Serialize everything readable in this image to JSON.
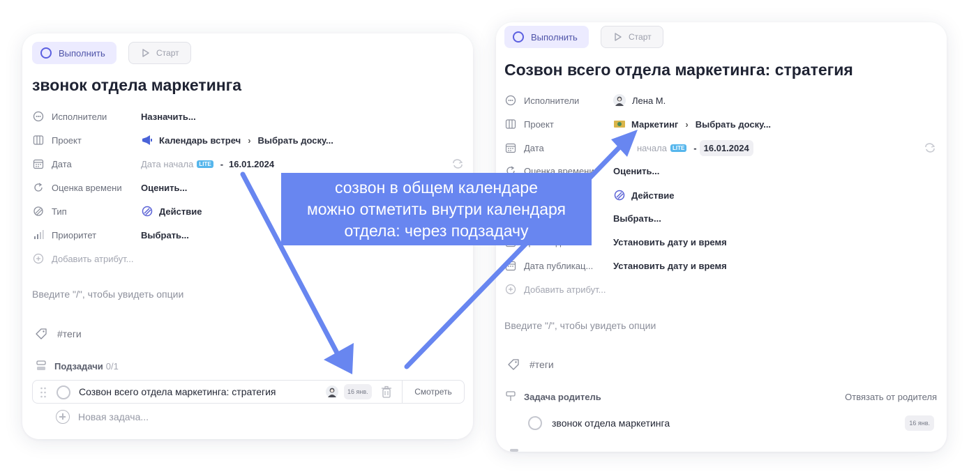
{
  "left_card": {
    "complete_button": "Выполнить",
    "start_button": "Старт",
    "title": "звонок отдела маркетинга",
    "attributes": [
      {
        "label": "Исполнители",
        "value": "Назначить..."
      },
      {
        "label": "Проект",
        "project": "Календарь встреч",
        "board": "Выбрать доску..."
      },
      {
        "label": "Дата",
        "start_placeholder": "Дата начала",
        "badge": "LITE",
        "separator": "-",
        "end_date": "16.01.2024"
      },
      {
        "label": "Оценка времени",
        "value": "Оценить..."
      },
      {
        "label": "Тип",
        "value": "Действие"
      },
      {
        "label": "Приоритет",
        "value": "Выбрать..."
      },
      {
        "label": "Добавить атрибут..."
      }
    ],
    "editor_placeholder": "Введите \"/\", чтобы увидеть опции",
    "tags": "#теги",
    "subtasks": {
      "heading": "Подзадачи",
      "count": "0/1",
      "items": [
        {
          "title": "Созвон всего отдела маркетинга: стратегия",
          "date": "16 янв.",
          "view_button": "Смотреть"
        }
      ],
      "new_task": "Новая задача..."
    }
  },
  "right_card": {
    "complete_button": "Выполнить",
    "start_button": "Старт",
    "title": "Созвон всего отдела маркетинга: стратегия",
    "attributes": [
      {
        "label": "Исполнители",
        "value": "Лена М."
      },
      {
        "label": "Проект",
        "project": "Маркетинг",
        "board": "Выбрать доску..."
      },
      {
        "label": "Дата",
        "start_placeholder": "начала",
        "badge": "LITE",
        "separator": "-",
        "end_date": "16.01.2024"
      },
      {
        "label": "Оценка времени",
        "value": "Оценить..."
      },
      {
        "value": "Действие"
      },
      {
        "value": "Выбрать..."
      },
      {
        "label": "Дата задачи",
        "value": "Установить дату и время"
      },
      {
        "label": "Дата публикац...",
        "value": "Установить дату и время"
      },
      {
        "label": "Добавить атрибут..."
      }
    ],
    "editor_placeholder": "Введите \"/\", чтобы увидеть опции",
    "tags": "#теги",
    "parent": {
      "heading": "Задача родитель",
      "unlink": "Отвязать от родителя",
      "title": "звонок отдела маркетинга",
      "date": "16 янв."
    }
  },
  "callout": {
    "lines": [
      "созвон в общем календаре",
      "можно отметить внутри календаря",
      "отдела: через подзадачу"
    ]
  },
  "colors": {
    "accent": "#5b5fe0",
    "callout": "#6886f0",
    "lite_badge": "#56b6ec"
  }
}
